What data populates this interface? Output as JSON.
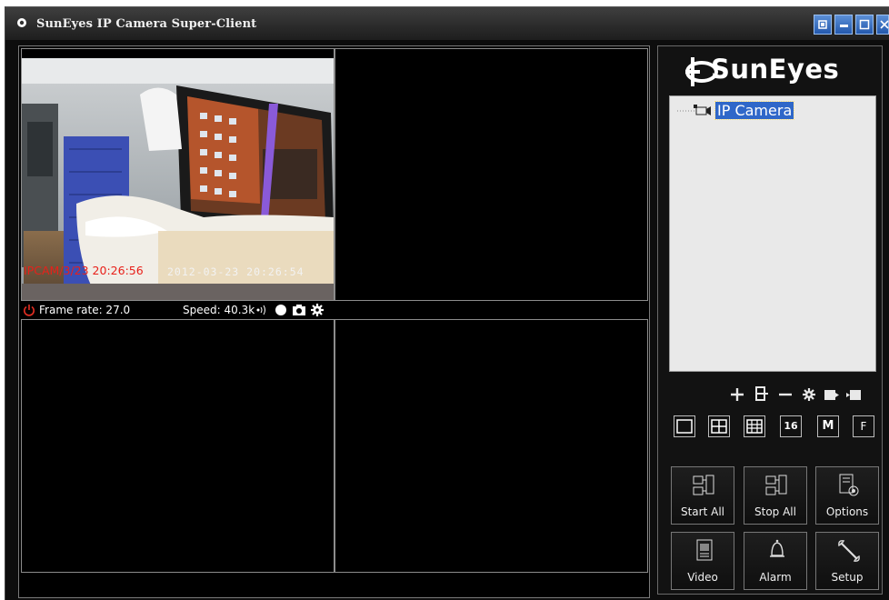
{
  "window": {
    "title": "SunEyes IP Camera Super-Client"
  },
  "logo": {
    "text": "SunEyes"
  },
  "tree": {
    "root_label": "IP Camera"
  },
  "camera1": {
    "overlay_left": "IPCAM/3/23 20:26:56",
    "overlay_right": "2012-03-23 20:26:54",
    "frame_rate_label": "Frame rate: 27.0",
    "speed_label": "Speed: 40.3k"
  },
  "views": [
    "1",
    "4",
    "9",
    "16",
    "M",
    "F"
  ],
  "actions": {
    "start_all": "Start All",
    "stop_all": "Stop All",
    "options": "Options",
    "video": "Video",
    "alarm": "Alarm",
    "setup": "Setup"
  },
  "colors": {
    "accent": "#2f67c9",
    "overlay_red": "#e8201a",
    "titlebar": "#2b2b2b"
  }
}
